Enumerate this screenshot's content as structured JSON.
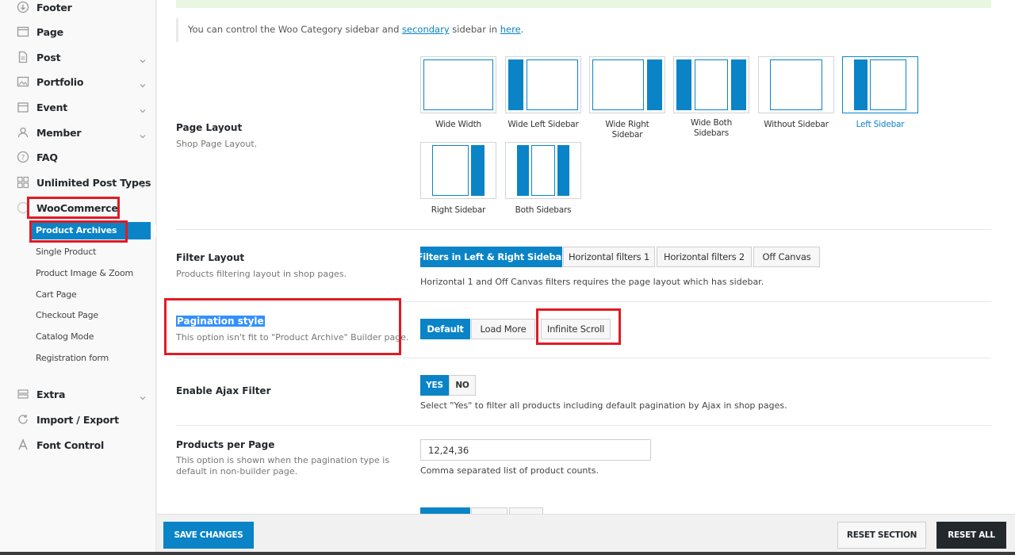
{
  "sidebar": {
    "items": [
      {
        "label": "Footer",
        "icon": "circle-down-icon"
      },
      {
        "label": "Page",
        "icon": "browser-window-icon"
      },
      {
        "label": "Post",
        "icon": "document-icon"
      },
      {
        "label": "Portfolio",
        "icon": "image-icon"
      },
      {
        "label": "Event",
        "icon": "calendar-icon"
      },
      {
        "label": "Member",
        "icon": "user-icon"
      },
      {
        "label": "FAQ",
        "icon": "question-circle-icon"
      },
      {
        "label": "Unlimited Post Types",
        "icon": "grid-icon"
      },
      {
        "label": "WooCommerce",
        "icon": "woocommerce-icon"
      },
      {
        "label": "Extra",
        "icon": "stack-icon"
      },
      {
        "label": "Import / Export",
        "icon": "refresh-icon"
      },
      {
        "label": "Font Control",
        "icon": "font-icon"
      }
    ],
    "woocommerce_sub": {
      "active": "Product Archives",
      "items": [
        "Single Product",
        "Product Image & Zoom",
        "Cart Page",
        "Checkout Page",
        "Catalog Mode",
        "Registration form"
      ]
    }
  },
  "notice": {
    "text_1": "You can control the Woo Category sidebar and ",
    "link_1": "secondary",
    "text_2": " sidebar in ",
    "link_2": "here",
    "text_3": "."
  },
  "page_layout": {
    "title": "Page Layout",
    "desc": "Shop Page Layout.",
    "options": [
      {
        "label": "Wide Width"
      },
      {
        "label": "Wide Left Sidebar"
      },
      {
        "label": "Wide Right Sidebar"
      },
      {
        "label": "Wide Both Sidebars"
      },
      {
        "label": "Without Sidebar"
      },
      {
        "label": "Left Sidebar"
      },
      {
        "label": "Right Sidebar"
      },
      {
        "label": "Both Sidebars"
      }
    ],
    "selected": "Left Sidebar"
  },
  "filter_layout": {
    "title": "Filter Layout",
    "desc": "Products filtering layout in shop pages.",
    "options": [
      "Filters in Left & Right Sidebar",
      "Horizontal filters 1",
      "Horizontal filters 2",
      "Off Canvas"
    ],
    "selected": "Filters in Left & Right Sidebar",
    "help": "Horizontal 1 and Off Canvas filters requires the page layout which has sidebar."
  },
  "pagination_style": {
    "title": "Pagination style",
    "desc": "This option isn't fit to \"Product Archive\" Builder page.",
    "options": [
      "Default",
      "Load More",
      "Infinite Scroll"
    ],
    "selected": "Default"
  },
  "ajax_filter": {
    "title": "Enable Ajax Filter",
    "yes": "YES",
    "no": "NO",
    "selected": "YES",
    "help": "Select \"Yes\" to filter all products including default pagination by Ajax in shop pages."
  },
  "products_per_page": {
    "title": "Products per Page",
    "desc_1": "This option is shown when the pagination type is",
    "desc_2": "default in non-builder page.",
    "value": "12,24,36",
    "help": "Comma separated list of product counts."
  },
  "footer": {
    "save": "SAVE CHANGES",
    "reset_section": "RESET SECTION",
    "reset_all": "RESET ALL"
  },
  "colors": {
    "accent": "#0a84c6",
    "highlight": "#e01b24",
    "dark": "#23282d"
  }
}
